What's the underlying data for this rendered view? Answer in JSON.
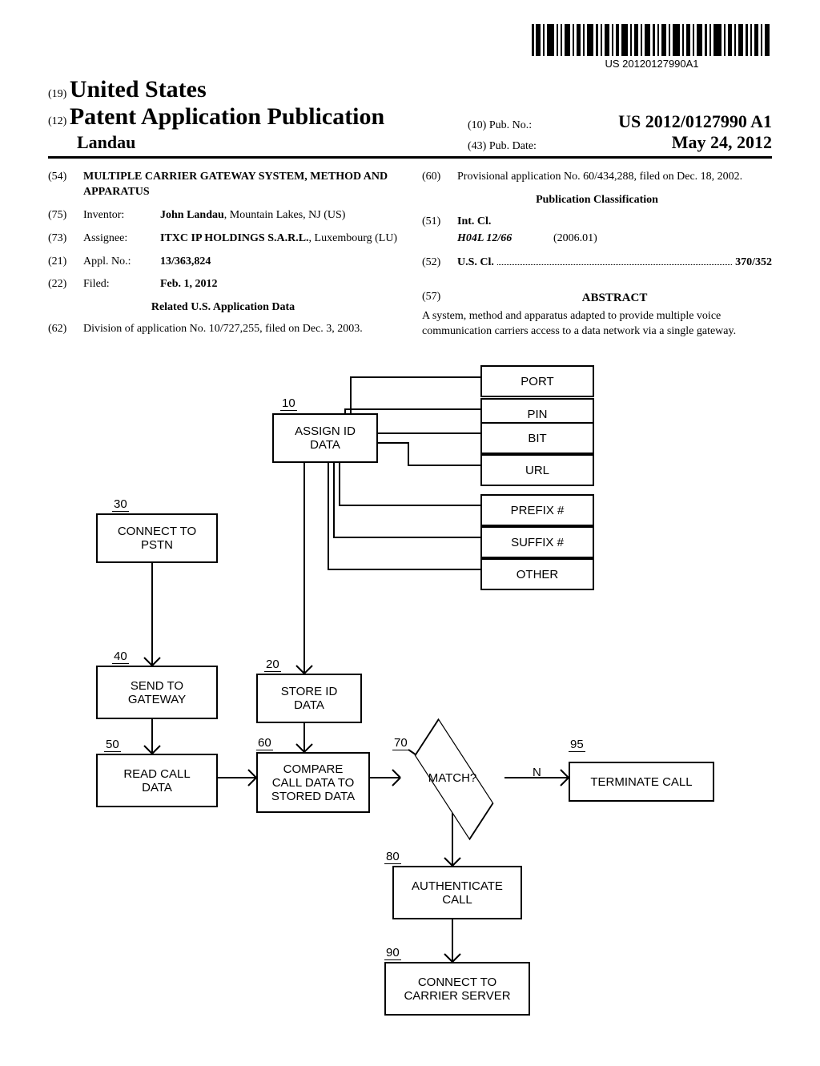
{
  "barcode_text": "US 20120127990A1",
  "header": {
    "code19": "(19)",
    "country": "United States",
    "code12": "(12)",
    "pub_title": "Patent Application Publication",
    "author": "Landau",
    "code10": "(10)",
    "pubno_label": "Pub. No.:",
    "pubno_value": "US 2012/0127990 A1",
    "code43": "(43)",
    "pubdate_label": "Pub. Date:",
    "pubdate_value": "May 24, 2012"
  },
  "left": {
    "code54": "(54)",
    "title": "MULTIPLE CARRIER GATEWAY SYSTEM, METHOD AND APPARATUS",
    "code75": "(75)",
    "inventor_label": "Inventor:",
    "inventor_value_bold": "John Landau",
    "inventor_value_rest": ", Mountain Lakes, NJ (US)",
    "code73": "(73)",
    "assignee_label": "Assignee:",
    "assignee_value_bold": "ITXC IP HOLDINGS S.A.R.L.",
    "assignee_value_rest": ", Luxembourg (LU)",
    "code21": "(21)",
    "appl_label": "Appl. No.:",
    "appl_value": "13/363,824",
    "code22": "(22)",
    "filed_label": "Filed:",
    "filed_value": "Feb. 1, 2012",
    "related_title": "Related U.S. Application Data",
    "code62": "(62)",
    "division_text": "Division of application No. 10/727,255, filed on Dec. 3, 2003."
  },
  "right": {
    "code60": "(60)",
    "provisional_text": "Provisional application No. 60/434,288, filed on Dec. 18, 2002.",
    "pubclass_title": "Publication Classification",
    "code51": "(51)",
    "intcl_label": "Int. Cl.",
    "intcl_code": "H04L 12/66",
    "intcl_date": "(2006.01)",
    "code52": "(52)",
    "uscl_label": "U.S. Cl.",
    "uscl_value": "370/352",
    "code57": "(57)",
    "abstract_label": "ABSTRACT",
    "abstract_text": "A system, method and apparatus adapted to provide multiple voice communication carriers access to a data network via a single gateway."
  },
  "chart_data": {
    "type": "flowchart",
    "nodes": [
      {
        "id": "10",
        "ref": "10",
        "label": "ASSIGN ID DATA",
        "shape": "rect"
      },
      {
        "id": "port",
        "label": "PORT",
        "shape": "rect"
      },
      {
        "id": "pin",
        "label": "PIN",
        "shape": "rect"
      },
      {
        "id": "bit",
        "label": "BIT",
        "shape": "rect"
      },
      {
        "id": "url",
        "label": "URL",
        "shape": "rect"
      },
      {
        "id": "prefix",
        "label": "PREFIX #",
        "shape": "rect"
      },
      {
        "id": "suffix",
        "label": "SUFFIX #",
        "shape": "rect"
      },
      {
        "id": "other",
        "label": "OTHER",
        "shape": "rect"
      },
      {
        "id": "20",
        "ref": "20",
        "label": "STORE ID DATA",
        "shape": "rect"
      },
      {
        "id": "30",
        "ref": "30",
        "label": "CONNECT TO PSTN",
        "shape": "rect"
      },
      {
        "id": "40",
        "ref": "40",
        "label": "SEND TO GATEWAY",
        "shape": "rect"
      },
      {
        "id": "50",
        "ref": "50",
        "label": "READ CALL DATA",
        "shape": "rect"
      },
      {
        "id": "60",
        "ref": "60",
        "label": "COMPARE CALL DATA TO STORED DATA",
        "shape": "rect"
      },
      {
        "id": "70",
        "ref": "70",
        "label": "MATCH?",
        "shape": "diamond"
      },
      {
        "id": "80",
        "ref": "80",
        "label": "AUTHENTICATE CALL",
        "shape": "rect"
      },
      {
        "id": "90",
        "ref": "90",
        "label": "CONNECT TO CARRIER SERVER",
        "shape": "rect"
      },
      {
        "id": "95",
        "ref": "95",
        "label": "TERMINATE CALL",
        "shape": "rect"
      }
    ],
    "edges": [
      {
        "from": "10",
        "to": "port"
      },
      {
        "from": "10",
        "to": "pin"
      },
      {
        "from": "10",
        "to": "bit"
      },
      {
        "from": "10",
        "to": "url"
      },
      {
        "from": "10",
        "to": "prefix"
      },
      {
        "from": "10",
        "to": "suffix"
      },
      {
        "from": "10",
        "to": "other"
      },
      {
        "from": "10",
        "to": "20"
      },
      {
        "from": "30",
        "to": "40"
      },
      {
        "from": "40",
        "to": "50"
      },
      {
        "from": "50",
        "to": "60"
      },
      {
        "from": "20",
        "to": "60"
      },
      {
        "from": "60",
        "to": "70"
      },
      {
        "from": "70",
        "to": "95",
        "label": "N"
      },
      {
        "from": "70",
        "to": "80"
      },
      {
        "from": "80",
        "to": "90"
      }
    ]
  },
  "diagram": {
    "n10": "ASSIGN ID\nDATA",
    "port": "PORT",
    "pin": "PIN",
    "bit": "BIT",
    "url": "URL",
    "prefix": "PREFIX #",
    "suffix": "SUFFIX #",
    "other": "OTHER",
    "n20": "STORE ID\nDATA",
    "n30": "CONNECT TO\nPSTN",
    "n40": "SEND TO\nGATEWAY",
    "n50": "READ CALL\nDATA",
    "n60": "COMPARE\nCALL DATA TO\nSTORED DATA",
    "n70": "MATCH?",
    "n80": "AUTHENTICATE\nCALL",
    "n90": "CONNECT TO\nCARRIER SERVER",
    "n95": "TERMINATE CALL",
    "ref10": "10",
    "ref20": "20",
    "ref30": "30",
    "ref40": "40",
    "ref50": "50",
    "ref60": "60",
    "ref70": "70",
    "ref80": "80",
    "ref90": "90",
    "ref95": "95",
    "n_label": "N"
  }
}
